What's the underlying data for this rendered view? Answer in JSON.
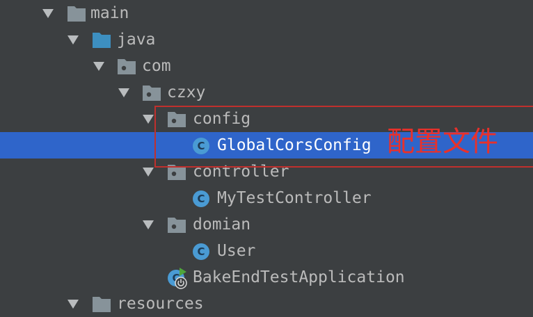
{
  "tree": {
    "items": [
      {
        "label": "main",
        "type": "folder-src",
        "expanded": true
      },
      {
        "label": "java",
        "type": "folder-source-root",
        "expanded": true
      },
      {
        "label": "com",
        "type": "package",
        "expanded": true
      },
      {
        "label": "czxy",
        "type": "package",
        "expanded": true
      },
      {
        "label": "config",
        "type": "package",
        "expanded": true
      },
      {
        "label": "GlobalCorsConfig",
        "type": "class",
        "selected": true,
        "badge": "C"
      },
      {
        "label": "controller",
        "type": "package",
        "expanded": true
      },
      {
        "label": "MyTestController",
        "type": "class",
        "badge": "C"
      },
      {
        "label": "domian",
        "type": "package",
        "expanded": true
      },
      {
        "label": "User",
        "type": "class",
        "badge": "C"
      },
      {
        "label": "BakeEndTestApplication",
        "type": "spring-boot-application",
        "badge": "C"
      },
      {
        "label": "resources",
        "type": "folder-resources",
        "expanded": true
      }
    ]
  },
  "annotation": {
    "text": "配置文件",
    "color": "#e8312b"
  },
  "colors": {
    "background": "#3c3f41",
    "selection": "#2f65ca",
    "text": "#bbbbbb",
    "class_badge": "#4a9bd4",
    "source_folder": "#3d8fc0",
    "highlight_border": "#c0302d"
  }
}
